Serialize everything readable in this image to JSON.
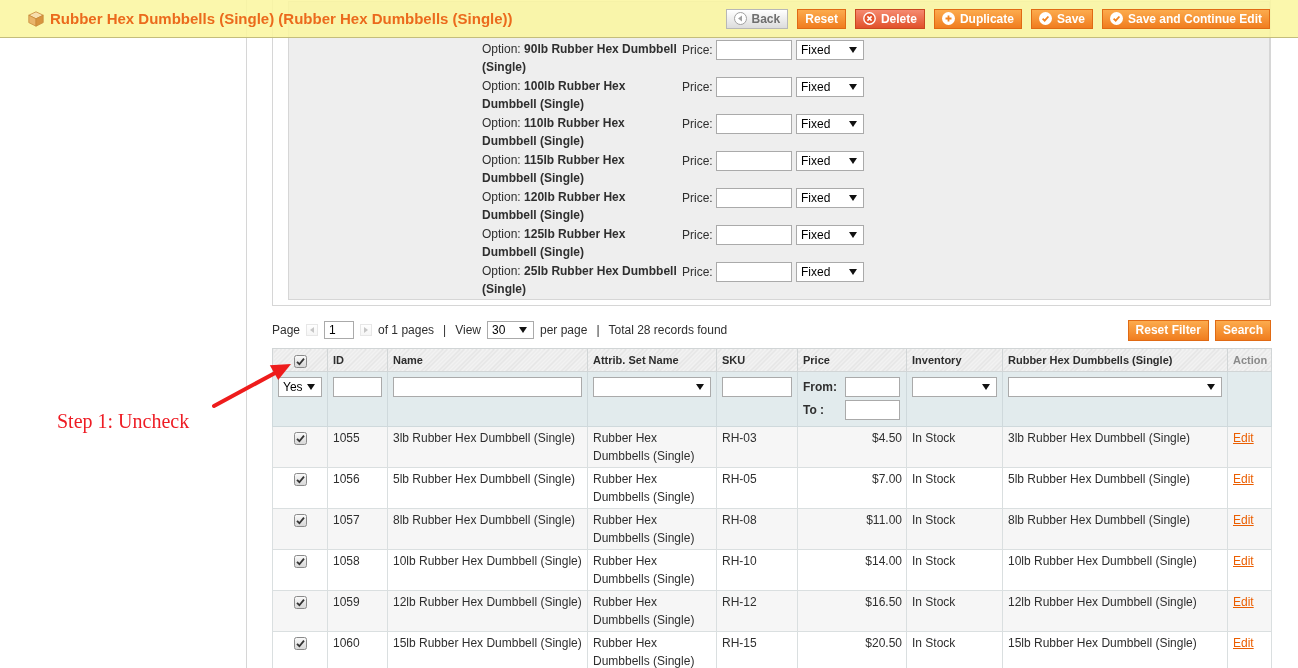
{
  "header": {
    "title": "Rubber Hex Dumbbells (Single) (Rubber Hex Dumbbells (Single))",
    "buttons": [
      {
        "label": "Back",
        "kind": "back"
      },
      {
        "label": "Reset",
        "kind": "plain"
      },
      {
        "label": "Delete",
        "kind": "delete"
      },
      {
        "label": "Duplicate",
        "kind": "add"
      },
      {
        "label": "Save",
        "kind": "save"
      },
      {
        "label": "Save and Continue Edit",
        "kind": "save"
      }
    ]
  },
  "options": [
    {
      "label": "Option: **90lb Rubber Hex Dumbbell (Single)**",
      "price_label": "Price:",
      "price_type": "Fixed"
    },
    {
      "label": "Option: **100lb Rubber Hex Dumbbell (Single)**",
      "price_label": "Price:",
      "price_type": "Fixed"
    },
    {
      "label": "Option: **110lb Rubber Hex Dumbbell (Single)**",
      "price_label": "Price:",
      "price_type": "Fixed"
    },
    {
      "label": "Option: **115lb Rubber Hex Dumbbell (Single)**",
      "price_label": "Price:",
      "price_type": "Fixed"
    },
    {
      "label": "Option: **120lb Rubber Hex Dumbbell (Single)**",
      "price_label": "Price:",
      "price_type": "Fixed"
    },
    {
      "label": "Option: **125lb Rubber Hex Dumbbell (Single)**",
      "price_label": "Price:",
      "price_type": "Fixed"
    },
    {
      "label": "Option: **25lb Rubber Hex Dumbbell (Single)**",
      "price_label": "Price:",
      "price_type": "Fixed"
    }
  ],
  "pager": {
    "items": [
      {
        "kind": "text",
        "text": "Page"
      },
      {
        "kind": "prev",
        "disabled": true
      },
      {
        "kind": "input",
        "value": "1"
      },
      {
        "kind": "next",
        "disabled": true
      },
      {
        "kind": "text",
        "text": "of 1 pages"
      },
      {
        "kind": "text",
        "text": "|"
      },
      {
        "kind": "text",
        "text": "View"
      },
      {
        "kind": "select",
        "value": "30"
      },
      {
        "kind": "text",
        "text": "per page"
      },
      {
        "kind": "text",
        "text": "|"
      },
      {
        "kind": "text",
        "text": "Total 28 records found"
      }
    ],
    "buttons": [
      "Reset Filter",
      "Search"
    ]
  },
  "grid": {
    "columns": [
      {
        "kind": "checkbox",
        "checked": true
      },
      {
        "kind": "text",
        "label": "ID",
        "sortable": true
      },
      {
        "kind": "text",
        "label": "Name",
        "sortable": true
      },
      {
        "kind": "text",
        "label": "Attrib. Set Name",
        "sortable": true
      },
      {
        "kind": "text",
        "label": "SKU",
        "sortable": true
      },
      {
        "kind": "text",
        "label": "Price",
        "sortable": true
      },
      {
        "kind": "text",
        "label": "Inventory",
        "sortable": true
      },
      {
        "kind": "text",
        "label": "Rubber Hex Dumbbells (Single)",
        "sortable": true
      },
      {
        "kind": "text",
        "label": "Action",
        "sortable": false
      }
    ],
    "filters": [
      {
        "kind": "select",
        "value": "Yes"
      },
      {
        "kind": "input"
      },
      {
        "kind": "input"
      },
      {
        "kind": "select"
      },
      {
        "kind": "input"
      },
      {
        "kind": "range",
        "from_label": "From:",
        "to_label": "To :"
      },
      {
        "kind": "select"
      },
      {
        "kind": "select"
      },
      {
        "kind": "none"
      }
    ],
    "rows": [
      {
        "checked": true,
        "id": "1055",
        "name": "3lb Rubber Hex Dumbbell (Single)",
        "attribute_set": "Rubber Hex Dumbbells (Single)",
        "sku": "RH-03",
        "price": "$4.50",
        "inventory": "In Stock",
        "attribute_value": "3lb Rubber Hex Dumbbell (Single)",
        "action": "Edit"
      },
      {
        "checked": true,
        "id": "1056",
        "name": "5lb Rubber Hex Dumbbell (Single)",
        "attribute_set": "Rubber Hex Dumbbells (Single)",
        "sku": "RH-05",
        "price": "$7.00",
        "inventory": "In Stock",
        "attribute_value": "5lb Rubber Hex Dumbbell (Single)",
        "action": "Edit"
      },
      {
        "checked": true,
        "id": "1057",
        "name": "8lb Rubber Hex Dumbbell (Single)",
        "attribute_set": "Rubber Hex Dumbbells (Single)",
        "sku": "RH-08",
        "price": "$11.00",
        "inventory": "In Stock",
        "attribute_value": "8lb Rubber Hex Dumbbell (Single)",
        "action": "Edit"
      },
      {
        "checked": true,
        "id": "1058",
        "name": "10lb Rubber Hex Dumbbell (Single)",
        "attribute_set": "Rubber Hex Dumbbells (Single)",
        "sku": "RH-10",
        "price": "$14.00",
        "inventory": "In Stock",
        "attribute_value": "10lb Rubber Hex Dumbbell (Single)",
        "action": "Edit"
      },
      {
        "checked": true,
        "id": "1059",
        "name": "12lb Rubber Hex Dumbbell (Single)",
        "attribute_set": "Rubber Hex Dumbbells (Single)",
        "sku": "RH-12",
        "price": "$16.50",
        "inventory": "In Stock",
        "attribute_value": "12lb Rubber Hex Dumbbell (Single)",
        "action": "Edit"
      },
      {
        "checked": true,
        "id": "1060",
        "name": "15lb Rubber Hex Dumbbell (Single)",
        "attribute_set": "Rubber Hex Dumbbells (Single)",
        "sku": "RH-15",
        "price": "$20.50",
        "inventory": "In Stock",
        "attribute_value": "15lb Rubber Hex Dumbbell (Single)",
        "action": "Edit"
      }
    ]
  },
  "annotation": {
    "text": "Step 1: Uncheck"
  }
}
